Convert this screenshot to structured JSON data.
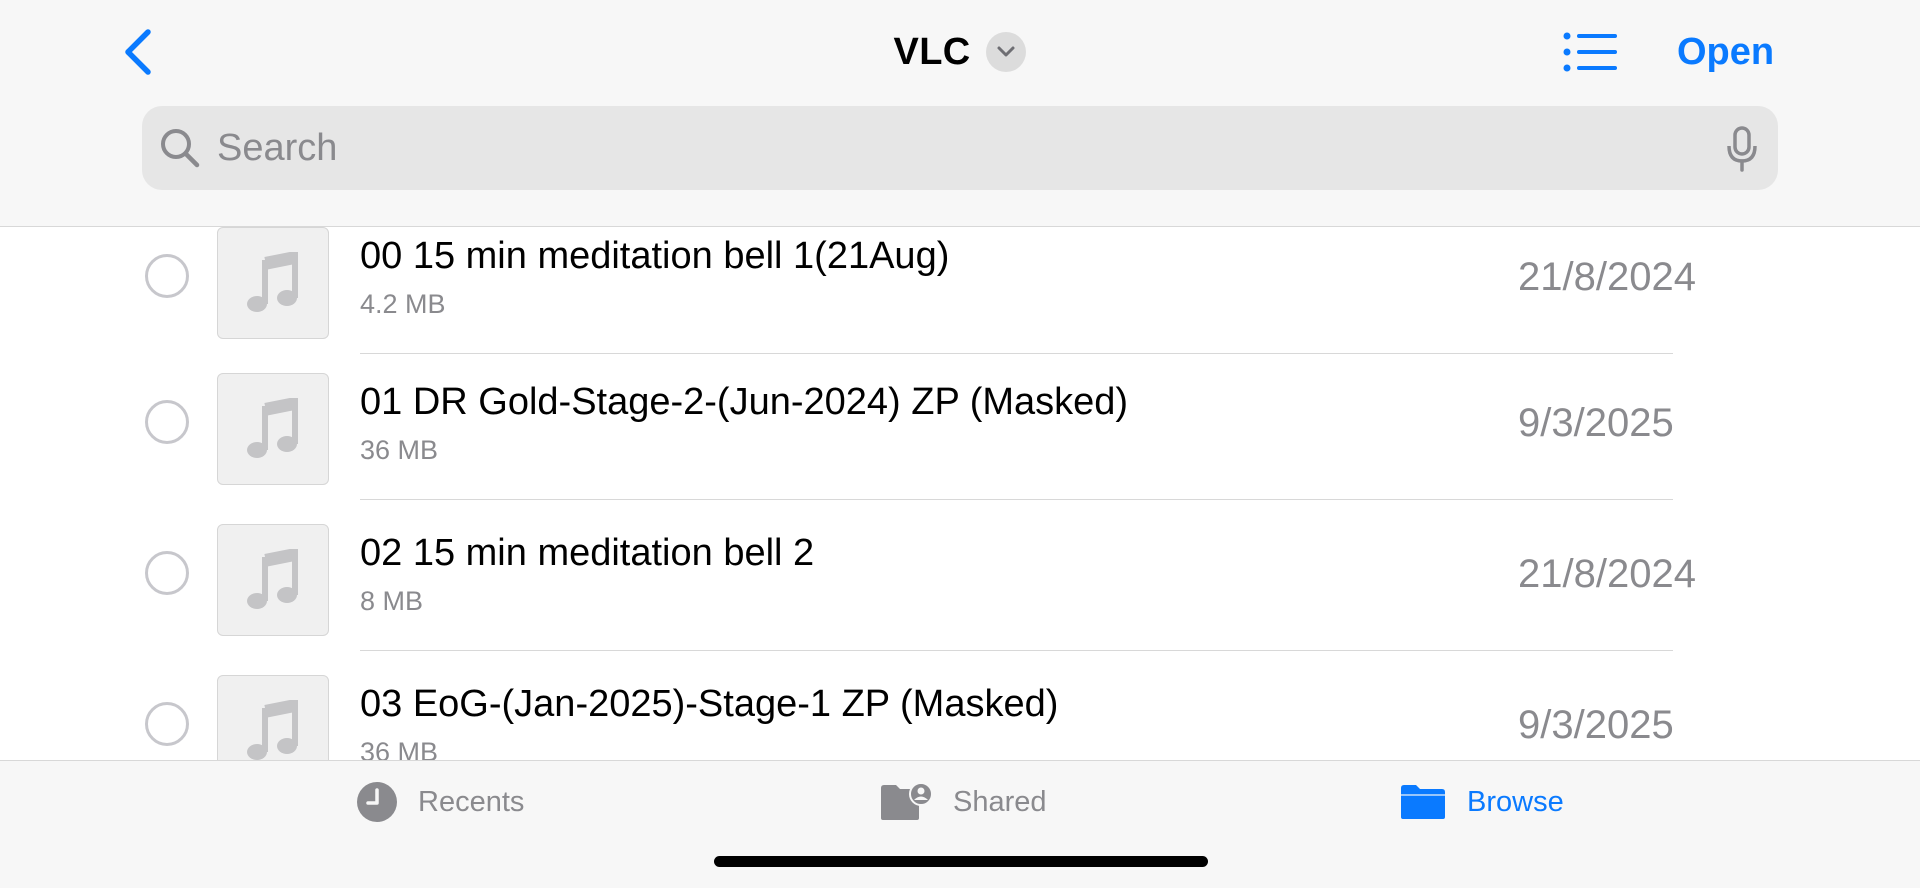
{
  "header": {
    "title": "VLC",
    "open_label": "Open"
  },
  "search": {
    "placeholder": "Search"
  },
  "files": [
    {
      "name": "00 15 min meditation bell 1(21Aug)",
      "size": "4.2 MB",
      "date": "21/8/2024"
    },
    {
      "name": "01 DR Gold-Stage-2-(Jun-2024) ZP (Masked)",
      "size": "36 MB",
      "date": "9/3/2025"
    },
    {
      "name": "02 15 min meditation bell 2",
      "size": "8 MB",
      "date": "21/8/2024"
    },
    {
      "name": "03 EoG-(Jan-2025)-Stage-1 ZP (Masked)",
      "size": "36 MB",
      "date": "9/3/2025"
    }
  ],
  "tabs": [
    {
      "label": "Recents",
      "icon": "clock-icon",
      "active": false
    },
    {
      "label": "Shared",
      "icon": "shared-folder-icon",
      "active": false
    },
    {
      "label": "Browse",
      "icon": "folder-icon",
      "active": true
    }
  ],
  "colors": {
    "accent": "#0a7aff",
    "secondary_text": "#8a8a8e",
    "bar_background": "#f7f7f7"
  }
}
